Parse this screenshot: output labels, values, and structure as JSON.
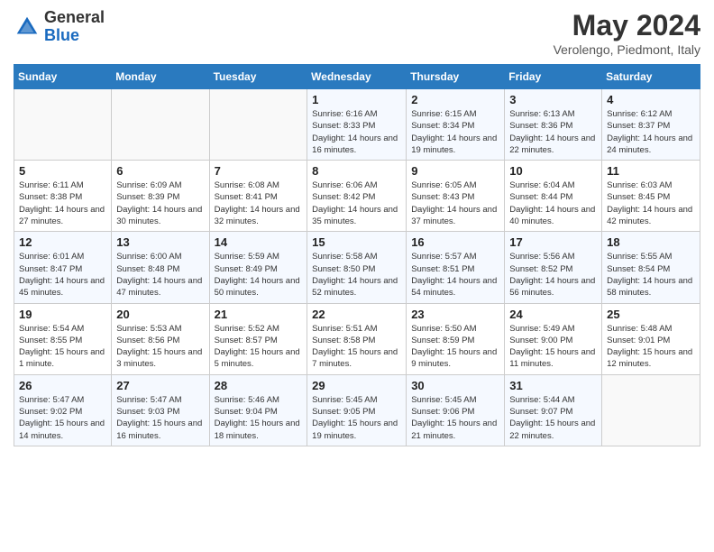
{
  "header": {
    "logo_general": "General",
    "logo_blue": "Blue",
    "title": "May 2024",
    "location": "Verolengo, Piedmont, Italy"
  },
  "columns": [
    "Sunday",
    "Monday",
    "Tuesday",
    "Wednesday",
    "Thursday",
    "Friday",
    "Saturday"
  ],
  "weeks": [
    [
      {
        "day": "",
        "info": ""
      },
      {
        "day": "",
        "info": ""
      },
      {
        "day": "",
        "info": ""
      },
      {
        "day": "1",
        "info": "Sunrise: 6:16 AM\nSunset: 8:33 PM\nDaylight: 14 hours and 16 minutes."
      },
      {
        "day": "2",
        "info": "Sunrise: 6:15 AM\nSunset: 8:34 PM\nDaylight: 14 hours and 19 minutes."
      },
      {
        "day": "3",
        "info": "Sunrise: 6:13 AM\nSunset: 8:36 PM\nDaylight: 14 hours and 22 minutes."
      },
      {
        "day": "4",
        "info": "Sunrise: 6:12 AM\nSunset: 8:37 PM\nDaylight: 14 hours and 24 minutes."
      }
    ],
    [
      {
        "day": "5",
        "info": "Sunrise: 6:11 AM\nSunset: 8:38 PM\nDaylight: 14 hours and 27 minutes."
      },
      {
        "day": "6",
        "info": "Sunrise: 6:09 AM\nSunset: 8:39 PM\nDaylight: 14 hours and 30 minutes."
      },
      {
        "day": "7",
        "info": "Sunrise: 6:08 AM\nSunset: 8:41 PM\nDaylight: 14 hours and 32 minutes."
      },
      {
        "day": "8",
        "info": "Sunrise: 6:06 AM\nSunset: 8:42 PM\nDaylight: 14 hours and 35 minutes."
      },
      {
        "day": "9",
        "info": "Sunrise: 6:05 AM\nSunset: 8:43 PM\nDaylight: 14 hours and 37 minutes."
      },
      {
        "day": "10",
        "info": "Sunrise: 6:04 AM\nSunset: 8:44 PM\nDaylight: 14 hours and 40 minutes."
      },
      {
        "day": "11",
        "info": "Sunrise: 6:03 AM\nSunset: 8:45 PM\nDaylight: 14 hours and 42 minutes."
      }
    ],
    [
      {
        "day": "12",
        "info": "Sunrise: 6:01 AM\nSunset: 8:47 PM\nDaylight: 14 hours and 45 minutes."
      },
      {
        "day": "13",
        "info": "Sunrise: 6:00 AM\nSunset: 8:48 PM\nDaylight: 14 hours and 47 minutes."
      },
      {
        "day": "14",
        "info": "Sunrise: 5:59 AM\nSunset: 8:49 PM\nDaylight: 14 hours and 50 minutes."
      },
      {
        "day": "15",
        "info": "Sunrise: 5:58 AM\nSunset: 8:50 PM\nDaylight: 14 hours and 52 minutes."
      },
      {
        "day": "16",
        "info": "Sunrise: 5:57 AM\nSunset: 8:51 PM\nDaylight: 14 hours and 54 minutes."
      },
      {
        "day": "17",
        "info": "Sunrise: 5:56 AM\nSunset: 8:52 PM\nDaylight: 14 hours and 56 minutes."
      },
      {
        "day": "18",
        "info": "Sunrise: 5:55 AM\nSunset: 8:54 PM\nDaylight: 14 hours and 58 minutes."
      }
    ],
    [
      {
        "day": "19",
        "info": "Sunrise: 5:54 AM\nSunset: 8:55 PM\nDaylight: 15 hours and 1 minute."
      },
      {
        "day": "20",
        "info": "Sunrise: 5:53 AM\nSunset: 8:56 PM\nDaylight: 15 hours and 3 minutes."
      },
      {
        "day": "21",
        "info": "Sunrise: 5:52 AM\nSunset: 8:57 PM\nDaylight: 15 hours and 5 minutes."
      },
      {
        "day": "22",
        "info": "Sunrise: 5:51 AM\nSunset: 8:58 PM\nDaylight: 15 hours and 7 minutes."
      },
      {
        "day": "23",
        "info": "Sunrise: 5:50 AM\nSunset: 8:59 PM\nDaylight: 15 hours and 9 minutes."
      },
      {
        "day": "24",
        "info": "Sunrise: 5:49 AM\nSunset: 9:00 PM\nDaylight: 15 hours and 11 minutes."
      },
      {
        "day": "25",
        "info": "Sunrise: 5:48 AM\nSunset: 9:01 PM\nDaylight: 15 hours and 12 minutes."
      }
    ],
    [
      {
        "day": "26",
        "info": "Sunrise: 5:47 AM\nSunset: 9:02 PM\nDaylight: 15 hours and 14 minutes."
      },
      {
        "day": "27",
        "info": "Sunrise: 5:47 AM\nSunset: 9:03 PM\nDaylight: 15 hours and 16 minutes."
      },
      {
        "day": "28",
        "info": "Sunrise: 5:46 AM\nSunset: 9:04 PM\nDaylight: 15 hours and 18 minutes."
      },
      {
        "day": "29",
        "info": "Sunrise: 5:45 AM\nSunset: 9:05 PM\nDaylight: 15 hours and 19 minutes."
      },
      {
        "day": "30",
        "info": "Sunrise: 5:45 AM\nSunset: 9:06 PM\nDaylight: 15 hours and 21 minutes."
      },
      {
        "day": "31",
        "info": "Sunrise: 5:44 AM\nSunset: 9:07 PM\nDaylight: 15 hours and 22 minutes."
      },
      {
        "day": "",
        "info": ""
      }
    ]
  ]
}
